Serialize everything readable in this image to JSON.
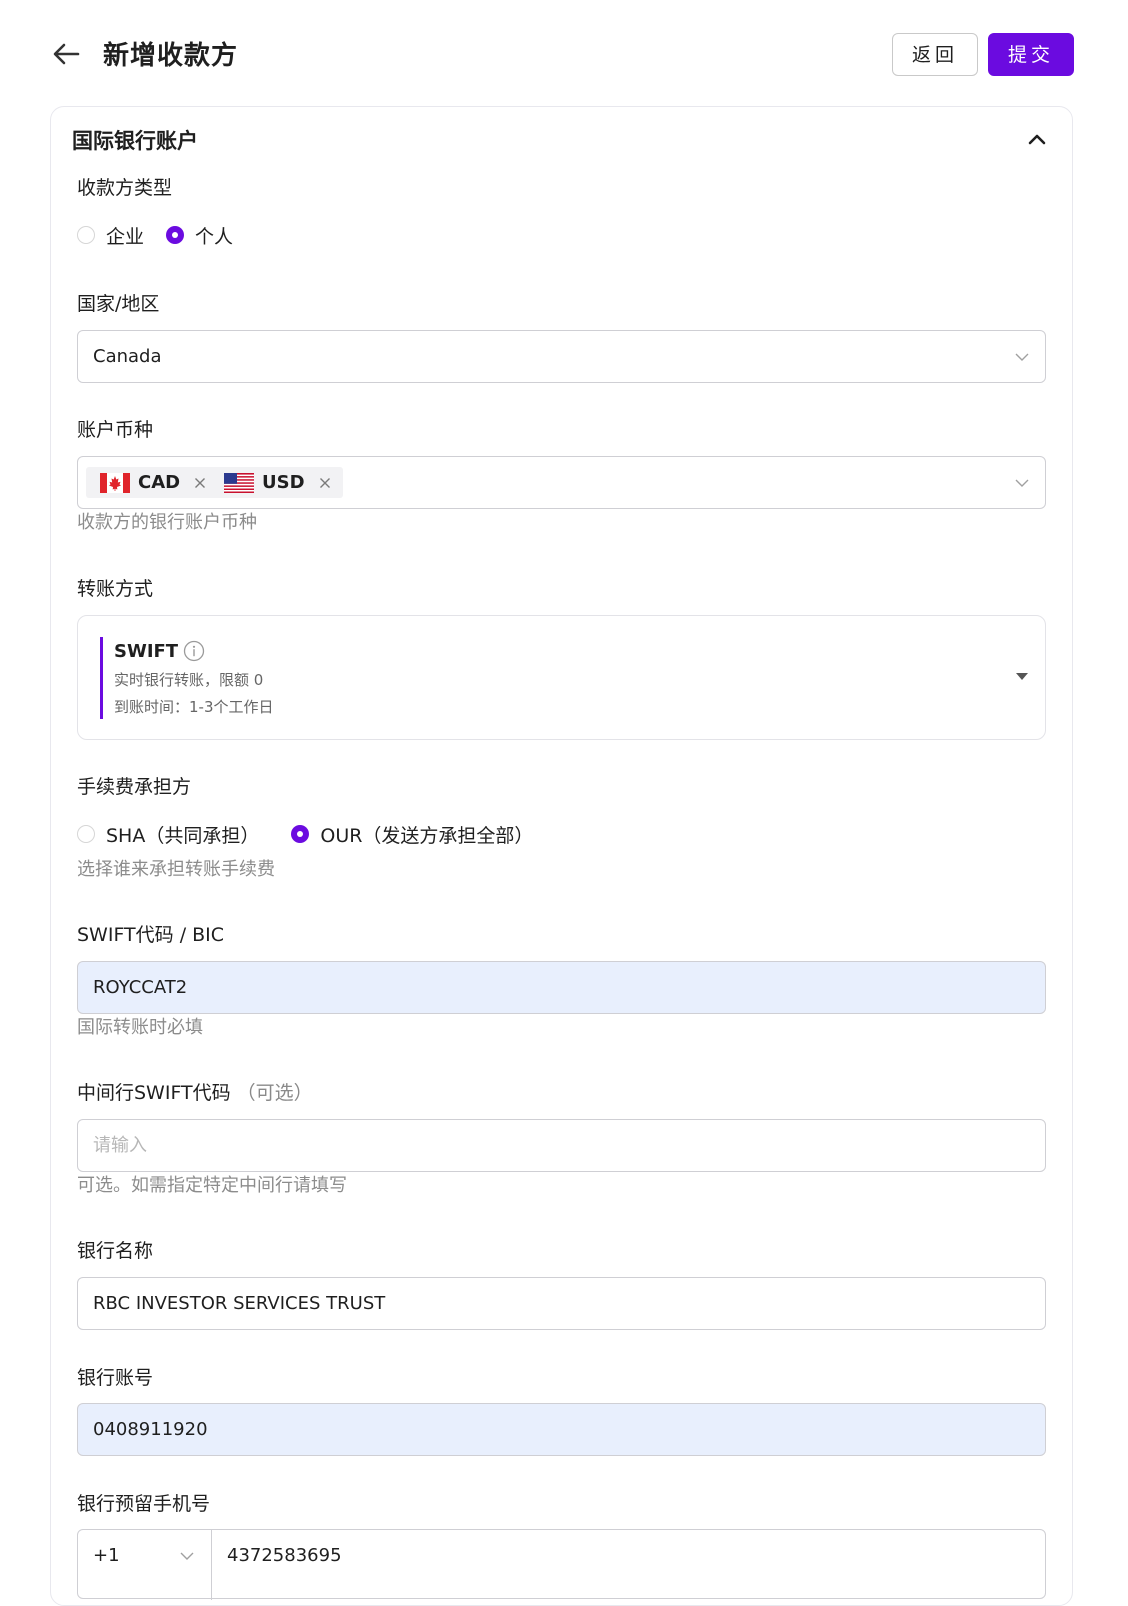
{
  "header": {
    "title": "新增收款方",
    "back_label": "返回",
    "submit_label": "提交"
  },
  "section": {
    "title": "国际银行账户"
  },
  "payee_type": {
    "label": "收款方类型",
    "options": [
      "企业",
      "个人"
    ],
    "selected": "个人"
  },
  "country": {
    "label": "国家/地区",
    "value": "Canada"
  },
  "currency": {
    "label": "账户币种",
    "tags": [
      "CAD",
      "USD"
    ],
    "hint": "收款方的银行账户币种"
  },
  "transfer": {
    "label": "转账方式",
    "name": "SWIFT",
    "line1": "实时银行转账，限额 0",
    "line2": "到账时间：1-3个工作日"
  },
  "fee": {
    "label": "手续费承担方",
    "options": [
      "SHA（共同承担）",
      "OUR（发送方承担全部）"
    ],
    "selected": "OUR（发送方承担全部）",
    "hint": "选择谁来承担转账手续费"
  },
  "swift": {
    "label": "SWIFT代码 / BIC",
    "value": "ROYCCAT2",
    "hint": "国际转账时必填"
  },
  "intermediary": {
    "label": "中间行SWIFT代码",
    "optional": "（可选）",
    "placeholder": "请输入",
    "hint": "可选。如需指定特定中间行请填写"
  },
  "bank_name": {
    "label": "银行名称",
    "value": "RBC INVESTOR SERVICES TRUST"
  },
  "account_no": {
    "label": "银行账号",
    "value": "0408911920"
  },
  "phone": {
    "label": "银行预留手机号",
    "code": "+1",
    "number": "4372583695"
  },
  "colors": {
    "accent": "#6b0be0",
    "filled_bg": "#e8effd"
  }
}
